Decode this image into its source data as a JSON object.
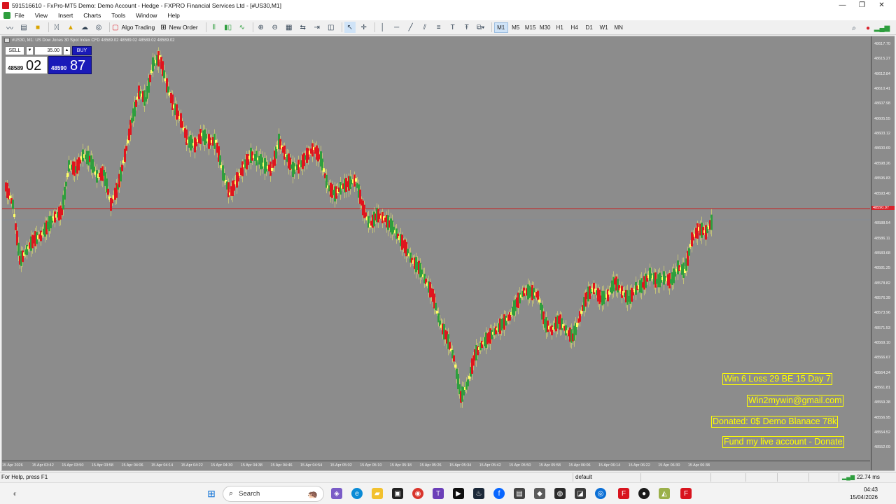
{
  "window": {
    "title": "591516610 - FxPro-MT5 Demo: Demo Account - Hedge - FXPRO Financial Services Ltd - [#US30,M1]",
    "controls": [
      "—",
      "❐",
      "✕"
    ]
  },
  "menu": [
    "File",
    "View",
    "Insert",
    "Charts",
    "Tools",
    "Window",
    "Help"
  ],
  "toolbar": {
    "algo_trading": "Algo Trading",
    "new_order": "New Order",
    "timeframes": [
      "M1",
      "M5",
      "M15",
      "M30",
      "H1",
      "H4",
      "D1",
      "W1",
      "MN"
    ],
    "active_timeframe": "M1"
  },
  "chart": {
    "header": "#US30, M1:  US Dow Jones 30 Spot Index CFD  48589.02 48589.02 48589.02 48589.02",
    "trade_panel": {
      "sell_label": "SELL",
      "buy_label": "BUY",
      "volume": "35.00",
      "bid_small": "48589",
      "bid_big": "02",
      "ask_small": "48590",
      "ask_big": "87"
    },
    "y_labels": [
      "48617.70",
      "48615.27",
      "48612.84",
      "48610.41",
      "48607.98",
      "48605.55",
      "48603.12",
      "48600.69",
      "48598.26",
      "48595.83",
      "48593.40",
      "48590.97",
      "48588.54",
      "48586.11",
      "48583.68",
      "48581.25",
      "48578.82",
      "48576.39",
      "48573.96",
      "48571.53",
      "48569.10",
      "48566.67",
      "48564.24",
      "48561.81",
      "48559.38",
      "48556.95",
      "48554.52",
      "48552.09"
    ],
    "current_price_label": "48590.97",
    "bid_line_label": "48588.54",
    "x_labels": [
      "15 Apr 2026",
      "15 Apr 03:42",
      "15 Apr 03:50",
      "15 Apr 03:58",
      "15 Apr 04:06",
      "15 Apr 04:14",
      "15 Apr 04:22",
      "15 Apr 04:30",
      "15 Apr 04:38",
      "15 Apr 04:46",
      "15 Apr 04:54",
      "15 Apr 05:02",
      "15 Apr 05:10",
      "15 Apr 05:18",
      "15 Apr 05:26",
      "15 Apr 05:34",
      "15 Apr 05:42",
      "15 Apr 05:50",
      "15 Apr 05:58",
      "15 Apr 06:06",
      "15 Apr 06:14",
      "15 Apr 06:22",
      "15 Apr 06:30",
      "15 Apr 06:38"
    ],
    "overlay_boxes": [
      "Win 6  Loss 29  BE 15  Day 7",
      "Win2mywin@gmail.com",
      "Donated: 0$  Demo Blanace 78k",
      "Fund my live account - Donate"
    ],
    "colors": {
      "bull": "#2e9e3e",
      "bear": "#e0141e",
      "doji": "#ffff66",
      "background": "#8c8c8c",
      "price_line": "#c81e1e"
    }
  },
  "status": {
    "help": "For Help, press F1",
    "profile": "default",
    "ping": "22.74 ms"
  },
  "taskbar": {
    "search_placeholder": "Search",
    "time": "04:43",
    "date": "15/04/2026"
  }
}
